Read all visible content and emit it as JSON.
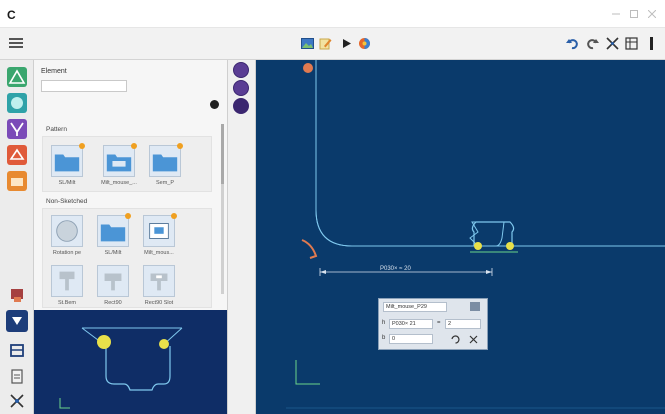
{
  "colors": {
    "canvas_bg": "#0a3a6b",
    "part_outline": "#7fc8ee",
    "accent_purple": "#5a3d94",
    "point_yellow": "#e8e04a",
    "point_green": "#6bd48a",
    "anchor_orange": "#e07a50"
  },
  "app": {
    "logo_text": "C"
  },
  "toolbar": {
    "left_icons": [
      "image-icon",
      "edit-icon",
      "play-icon",
      "globe-icon"
    ],
    "right_icons": [
      "undo-icon",
      "redo-icon",
      "snap-icon",
      "grid-icon",
      "more-icon"
    ]
  },
  "left_rail": {
    "items": [
      "shapes-icon",
      "fill-icon",
      "shield-icon",
      "profile-icon",
      "folder-icon",
      "camera-icon",
      "library-icon",
      "board-icon",
      "clipboard-icon",
      "split-icon"
    ]
  },
  "library": {
    "element_label": "Element",
    "search_value": "",
    "sections": [
      {
        "title": "Pattern",
        "items": [
          "SL/Milt",
          "Milt_mouse_...",
          "Sem_P"
        ]
      },
      {
        "title": "Non-Sketched",
        "items": [
          "Rotation pe",
          "SL/Milt",
          "Milt_mous..."
        ]
      },
      {
        "title": "",
        "items": [
          "St.Bem",
          "Rect90",
          "Rect90 Slot"
        ]
      }
    ]
  },
  "canvas": {
    "dimension_text": "P030× ≈ 20"
  },
  "dialog": {
    "title": "Milt_mouse_P29",
    "row1_label": "h",
    "row1_value": "P030× 21",
    "row1_op": "=",
    "row1_result": "2",
    "row2_label": "b",
    "row2_value": "0"
  }
}
